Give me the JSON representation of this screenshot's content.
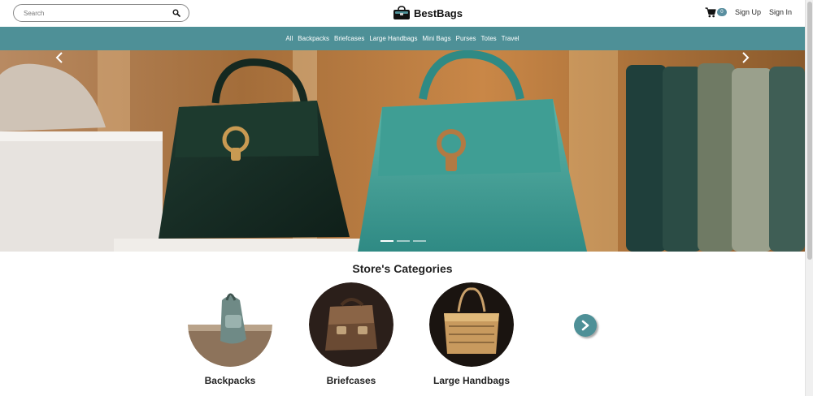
{
  "header": {
    "search_placeholder": "Search",
    "brand_name": "BestBags",
    "cart_count": "0",
    "sign_up": "Sign Up",
    "sign_in": "Sign In"
  },
  "nav": {
    "items": [
      "All",
      "Backpacks",
      "Briefcases",
      "Large Handbags",
      "Mini Bags",
      "Purses",
      "Totes",
      "Travel"
    ]
  },
  "hero": {
    "slide_count": 3,
    "active_slide": 1,
    "prev_icon": "chevron-left-icon",
    "next_icon": "chevron-right-icon"
  },
  "categories": {
    "title": "Store's Categories",
    "items": [
      {
        "label": "Backpacks"
      },
      {
        "label": "Briefcases"
      },
      {
        "label": "Large Handbags"
      }
    ],
    "next_icon": "chevron-right-icon"
  },
  "colors": {
    "accent": "#4e9097",
    "badge": "#5a8fa0"
  }
}
